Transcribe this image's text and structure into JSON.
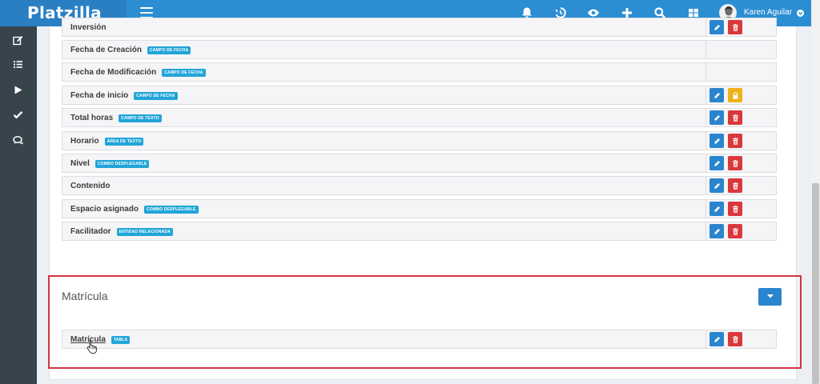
{
  "app": {
    "brand": "Platzilla"
  },
  "header": {
    "user_name": "Karen Aguilar",
    "icons": [
      "bell-icon",
      "history-icon",
      "eye-icon",
      "plus-icon",
      "search-icon",
      "grid-icon"
    ]
  },
  "sidebar": {
    "items": [
      "edit-icon",
      "list-icon",
      "play-icon",
      "check-icon",
      "comments-icon"
    ]
  },
  "fields": [
    {
      "name": "Inversión",
      "badge": "",
      "actions": [
        "edit",
        "delete"
      ]
    },
    {
      "name": "Fecha de Creación",
      "badge": "CAMPO DE FECHA",
      "actions": []
    },
    {
      "name": "Fecha de Modificación",
      "badge": "CAMPO DE FECHA",
      "actions": []
    },
    {
      "name": "Fecha de inicio",
      "badge": "CAMPO DE FECHA",
      "actions": [
        "edit",
        "lock"
      ]
    },
    {
      "name": "Total horas",
      "badge": "CAMPO DE TEXTO",
      "actions": [
        "edit",
        "delete"
      ]
    },
    {
      "name": "Horario",
      "badge": "ÁREA DE TEXTO",
      "actions": [
        "edit",
        "delete"
      ]
    },
    {
      "name": "Nivel",
      "badge": "COMBO DESPLEGABLE",
      "actions": [
        "edit",
        "delete"
      ]
    },
    {
      "name": "Contenido",
      "badge": "",
      "actions": [
        "edit",
        "delete"
      ]
    },
    {
      "name": "Espacio asignado",
      "badge": "COMBO DESPLEGABLE",
      "actions": [
        "edit",
        "delete"
      ]
    },
    {
      "name": "Facilitador",
      "badge": "ENTIDAD RELACIONADA",
      "actions": [
        "edit",
        "delete"
      ]
    }
  ],
  "section": {
    "title": "Matrícula",
    "rows": [
      {
        "name": "Matrícula",
        "badge": "TABLA",
        "actions": [
          "edit",
          "delete"
        ]
      }
    ]
  },
  "colors": {
    "topbar": "#2b8ed2",
    "sidebar": "#37444c",
    "badge": "#21a5d8",
    "edit_button": "#2a85ce",
    "delete_button": "#d9383c",
    "lock_button": "#f0b21b",
    "highlight": "#d0353f"
  }
}
